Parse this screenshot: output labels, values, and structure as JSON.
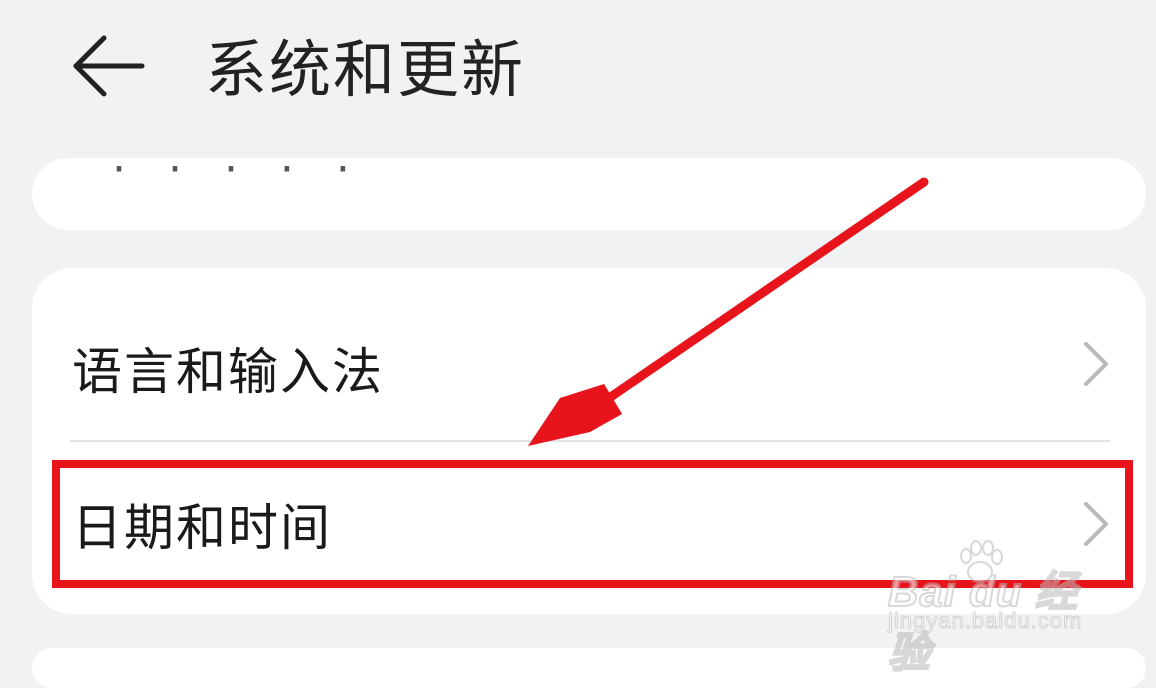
{
  "header": {
    "back_icon": "arrow-left-icon",
    "title": "系统和更新"
  },
  "card_top": {
    "partial_item_text": "· · ·  · ·"
  },
  "settings": {
    "items": [
      {
        "label": "语言和输入法",
        "icon": "chevron-right-icon"
      },
      {
        "label": "日期和时间",
        "icon": "chevron-right-icon"
      }
    ]
  },
  "annotation": {
    "highlight_color": "#e8141c",
    "arrow_color": "#e8141c",
    "highlighted_item": "日期和时间"
  },
  "watermark": {
    "logo": "Bai du 经验",
    "url": "jingyan.baidu.com"
  },
  "colors": {
    "background": "#f1f2f4",
    "card": "#ffffff",
    "text": "#1a1a1a",
    "chevron": "#b8b8b8"
  }
}
